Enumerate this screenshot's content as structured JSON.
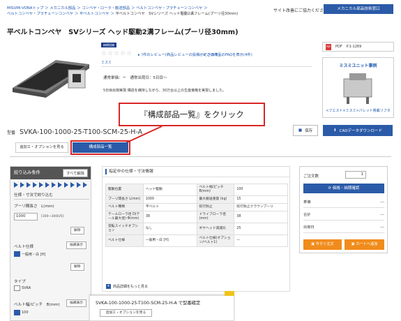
{
  "breadcrumb": [
    "MISUMI-VONAトップ",
    "メカニカル部品",
    "コンベヤ・ローラ・搬送部品",
    "ベルトコンベヤ・プラチェーンコンベヤ",
    "ベルトコンベヤ・プラチェーンコンベヤ",
    "平ベルトコンベヤ",
    "平ベルトコンベヤ　SVシリーズ ヘッド駆動2溝フレーム(プーリ径30mm)"
  ],
  "utility_link": "サイト改善にご協力ください",
  "header_button": "メカニカル部品技術窓口",
  "product_title": "平ベルトコンベヤ　SVシリーズ ヘッド駆動2溝フレーム(プーリ径30mm)",
  "new_badge": "納期短縮",
  "review_link": "ﾜ件のレビュー(商品レビューの投稿ができます)",
  "faq_link": "この商品のFAQを表示(4件)",
  "brand_link": "ミスミ",
  "ship_text": "通常単価：ー　通常出荷日：5日目〜",
  "note_text": "5日目出荷実現  構造を維持しながら、30万台以上の生産価格を実現しました。",
  "pdf": {
    "label": "PDF",
    "page": "P.1-1269"
  },
  "unit_example": {
    "title": "ミスミユニット事例",
    "link": "<フエスト×ミスミ>パレット移載リフタ"
  },
  "callout": "『構成部品一覧』をクリック",
  "partno": {
    "label": "型番",
    "value": "SVKA-100-1000-25-T100-SCM-25-H-A"
  },
  "save_button": "保存",
  "cad_button": "CADデータダウンロード",
  "tabs": [
    "追加工・オプションを見る",
    "構成部品一覧"
  ],
  "filter": {
    "title": "絞り込み条件",
    "clear_all": "すべて解除",
    "section": "仕様・寸法で絞り込む",
    "pulley_label": "プーリ間長さ　L(mm)",
    "pulley_value": "1000",
    "pulley_range": "[300~3000/5]",
    "clear": "解除",
    "belt_spec_label": "ベルト仕様",
    "show_candidates": "候補表示",
    "belt_spec_value": "一般用・白 [H]",
    "clear2": "解除",
    "type_label": "タイプ",
    "type_value": "SVKA",
    "belt_width_label": "ベルト幅/ピッチ　B(mm)",
    "show_candidates2": "候補表示",
    "belt_width_value": "100"
  },
  "specs": {
    "title": "指定中の仕様・寸法情報",
    "rows": [
      [
        "駆動位置",
        "ヘッド駆動",
        "ベルト幅/ピッチ B(mm)",
        "100"
      ],
      [
        "プーリ間長さ L(mm)",
        "1000",
        "最大搬送重量 (kg)",
        "15"
      ],
      [
        "ベルト種類",
        "平ベルト",
        "蛇行防止",
        "蛇行防止クラウンプーリ"
      ],
      [
        "テールローラ径 D(テール最大径) Φ(mm)",
        "38",
        "ドライブローラ径 (mm)",
        "38"
      ],
      [
        "逆転スイッチオプション",
        "なし",
        "ギヤヘッド減速比",
        "25"
      ],
      [
        "ベルト仕様",
        "一般用・白 [H]",
        "ベルト仕様(オプション/ベルト1)",
        "ー"
      ]
    ],
    "more": "商品詳細をもっと見る"
  },
  "order_panel": {
    "qty_label": "ご注文数",
    "qty": "1",
    "price_button": "価格・納期確認",
    "rows": [
      [
        "単価",
        "---"
      ],
      [
        "合計",
        "---"
      ],
      [
        "出荷日",
        "---"
      ]
    ],
    "order_now": "今すぐ注文",
    "add_cart": "カートへ追加"
  },
  "sticky": {
    "text": "SVKA-100-1000-25-T100-SCM-25-H-A で型番確定",
    "button": "追加工・オプションを見る"
  }
}
